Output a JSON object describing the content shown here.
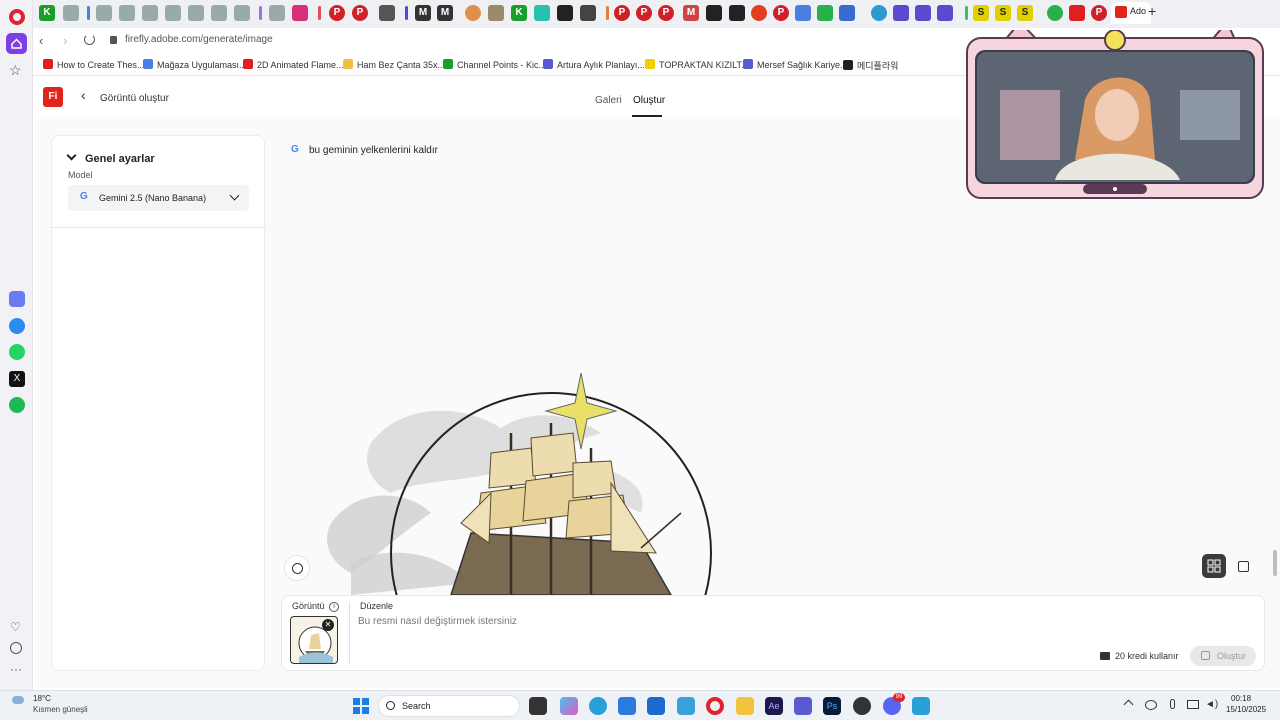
{
  "browser": {
    "url": "firefly.adobe.com/generate/image",
    "active_tab_label": "Ado",
    "new_tab_glyph": "+"
  },
  "bookmarks": [
    {
      "label": "How to Create Thes...",
      "color": "#e02020"
    },
    {
      "label": "Mağaza Uygulaması...",
      "color": "#4a7ee0"
    },
    {
      "label": "2D Animated Flame...",
      "color": "#e02020"
    },
    {
      "label": "Ham Bez Çanta 35x...",
      "color": "#f0c040"
    },
    {
      "label": "Channel Points - Kic...",
      "color": "#1a9e2a"
    },
    {
      "label": "Artura Aylık Planlayı...",
      "color": "#5a5ad0"
    },
    {
      "label": "TOPRAKTAN KIZILT...",
      "color": "#f0d000"
    },
    {
      "label": "Mersef Sağlık Kariye...",
      "color": "#5a5ad0"
    },
    {
      "label": "메디플라워",
      "color": "#222222"
    }
  ],
  "app": {
    "logo_text": "Fi",
    "back_label": "Görüntü oluştur",
    "nav": [
      {
        "label": "Galeri"
      },
      {
        "label": "Oluştur"
      }
    ],
    "active_nav": "Oluştur"
  },
  "settings": {
    "section_title": "Genel ayarlar",
    "model_label": "Model",
    "model_value": "Gemini 2.5 (Nano Banana)"
  },
  "canvas": {
    "prompt_text": "bu geminin yelkenlerini kaldır"
  },
  "prompt": {
    "image_label": "Görüntü",
    "edit_label": "Düzenle",
    "placeholder": "Bu resmi nasıl değiştirmek istersiniz",
    "credits": "20 kredi kullanır",
    "generate_label": "Oluştur"
  },
  "taskbar": {
    "weather_temp": "18°C",
    "weather_desc": "Kısmen güneşli",
    "search_label": "Search",
    "time": "00:18",
    "date": "15/10/2025",
    "chat_badge": "99"
  },
  "colors": {
    "firefly_red": "#e1251b",
    "browser_accent": "#7b3fe4"
  }
}
